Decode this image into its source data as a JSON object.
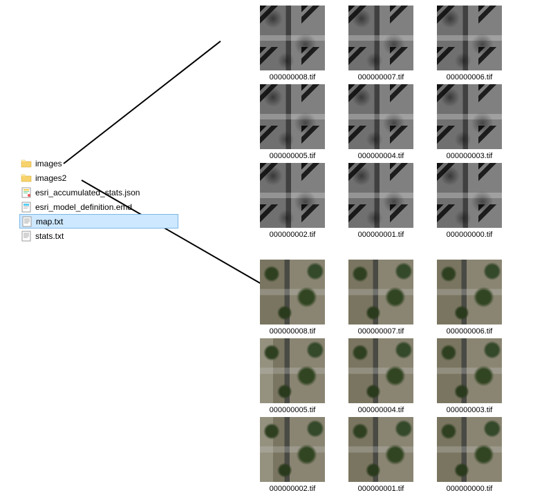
{
  "files": [
    {
      "name": "images",
      "icon": "folder"
    },
    {
      "name": "images2",
      "icon": "folder"
    },
    {
      "name": "esri_accumulated_stats.json",
      "icon": "json"
    },
    {
      "name": "esri_model_definition.emd",
      "icon": "emd"
    },
    {
      "name": "map.txt",
      "icon": "txt",
      "selected": true
    },
    {
      "name": "stats.txt",
      "icon": "txt"
    }
  ],
  "grid_top": [
    "000000008.tif",
    "000000007.tif",
    "000000006.tif",
    "000000005.tif",
    "000000004.tif",
    "000000003.tif",
    "000000002.tif",
    "000000001.tif",
    "000000000.tif"
  ],
  "grid_bottom": [
    "000000008.tif",
    "000000007.tif",
    "000000006.tif",
    "000000005.tif",
    "000000004.tif",
    "000000003.tif",
    "000000002.tif",
    "000000001.tif",
    "000000000.tif"
  ]
}
